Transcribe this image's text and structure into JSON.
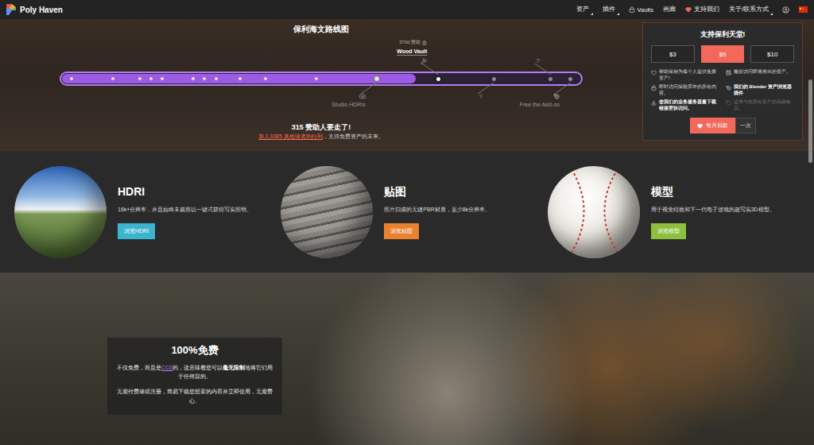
{
  "nav": {
    "logo": "Poly Haven",
    "items": [
      {
        "label": "资产",
        "dropdown": true,
        "icon": false
      },
      {
        "label": "插件",
        "dropdown": true,
        "icon": false
      },
      {
        "label": "Vaults",
        "dropdown": false,
        "icon": true
      },
      {
        "label": "画廊",
        "dropdown": false,
        "icon": false
      },
      {
        "label": "支持我们",
        "dropdown": false,
        "icon": true
      },
      {
        "label": "关于/联系方式",
        "dropdown": true,
        "icon": false
      }
    ]
  },
  "roadmap": {
    "title": "保利海文路线图",
    "level": 0.68,
    "milestones": [
      {
        "kind": "minor",
        "level": 0.014,
        "reached": true
      },
      {
        "kind": "minor",
        "level": 0.094,
        "reached": true
      },
      {
        "kind": "minor",
        "level": 0.147,
        "reached": true
      },
      {
        "kind": "minor",
        "level": 0.169,
        "reached": true
      },
      {
        "kind": "minor",
        "level": 0.191,
        "reached": true
      },
      {
        "kind": "minor",
        "level": 0.251,
        "reached": true
      },
      {
        "kind": "minor",
        "level": 0.272,
        "reached": true
      },
      {
        "kind": "minor",
        "level": 0.296,
        "reached": true
      },
      {
        "kind": "minor",
        "level": 0.342,
        "reached": true
      },
      {
        "kind": "minor",
        "level": 0.392,
        "reached": true
      },
      {
        "kind": "minor",
        "level": 0.491,
        "reached": true
      },
      {
        "kind": "major",
        "level": 0.608,
        "reached": true,
        "current": false,
        "label": "Studio HDRIs",
        "side": "below",
        "has_icon": true
      },
      {
        "kind": "major",
        "level": 0.728,
        "reached": false,
        "current": true,
        "label": "Wood Vault",
        "sponsors": "3700 赞助",
        "side": "above",
        "has_icon": true
      },
      {
        "kind": "major",
        "level": 0.836,
        "reached": false,
        "current": false,
        "label": "?",
        "side": "below",
        "has_icon": false
      },
      {
        "kind": "major",
        "level": 0.947,
        "reached": false,
        "current": false,
        "label": "?",
        "side": "above",
        "has_icon": false
      },
      {
        "kind": "major",
        "level": 0.986,
        "reached": false,
        "current": false,
        "label": "Free the Add-on",
        "side": "below",
        "has_icon": true
      }
    ],
    "remaining": "315 赞助人要走了!",
    "join": {
      "link": "加入3385 其他读者的行列",
      "text": "，支持免费资产的未来。"
    }
  },
  "donate": {
    "title": "支持保利天堂!",
    "amounts": [
      {
        "label": "$3",
        "selected": false
      },
      {
        "label": "$5",
        "selected": true
      },
      {
        "label": "$10",
        "selected": false
      }
    ],
    "perks": [
      {
        "text": "帮助保持为每个人提供免费资产!",
        "highlighted": false,
        "disabled": false
      },
      {
        "text": "最前访问即将推出的资产。",
        "highlighted": false,
        "disabled": false
      },
      {
        "text": "即时访问保险库中的所有内容。",
        "highlighted": false,
        "disabled": false
      },
      {
        "text": "我们的 Blender 资产浏览器插件",
        "highlighted": true,
        "disabled": false
      },
      {
        "text": "使我们的业务服务器量下载链接更快访问。",
        "highlighted": true,
        "disabled": false
      },
      {
        "text": "证书与你所有资产的高级会员。",
        "highlighted": false,
        "disabled": true
      }
    ],
    "monthly": "每月捐款",
    "once": "一次"
  },
  "categories": [
    {
      "kind": "hdri",
      "title": "HDRI",
      "description": "16k+分辨率，并且始终未裁剪以一键式获得写实照明。",
      "button": "浏览HDRI",
      "color": "#3cb4cf"
    },
    {
      "kind": "texture",
      "title": "贴图",
      "description": "照片扫描的无缝PBR材质，至少8k分辨率。",
      "button": "浏览贴图",
      "color": "#e8822f"
    },
    {
      "kind": "model",
      "title": "模型",
      "description": "用于视觉特效和下一代电子游戏的超写实3D模型。",
      "button": "浏览模型",
      "color": "#8dc03f"
    }
  ],
  "free": {
    "title": "100%免费",
    "paragraphs": [
      [
        {
          "kind": "text",
          "text": "不仅免费，而且是"
        },
        {
          "kind": "link",
          "text": "CC0"
        },
        {
          "kind": "text",
          "text": "的，这意味着您可以"
        },
        {
          "kind": "bold",
          "text": "毫无限制"
        },
        {
          "kind": "text",
          "text": "地将它们用于任何目的。"
        }
      ],
      [
        {
          "kind": "text",
          "text": "无需付费墙或注册，简易下载您想要的内容并立即使用，无需费心。"
        }
      ]
    ]
  }
}
